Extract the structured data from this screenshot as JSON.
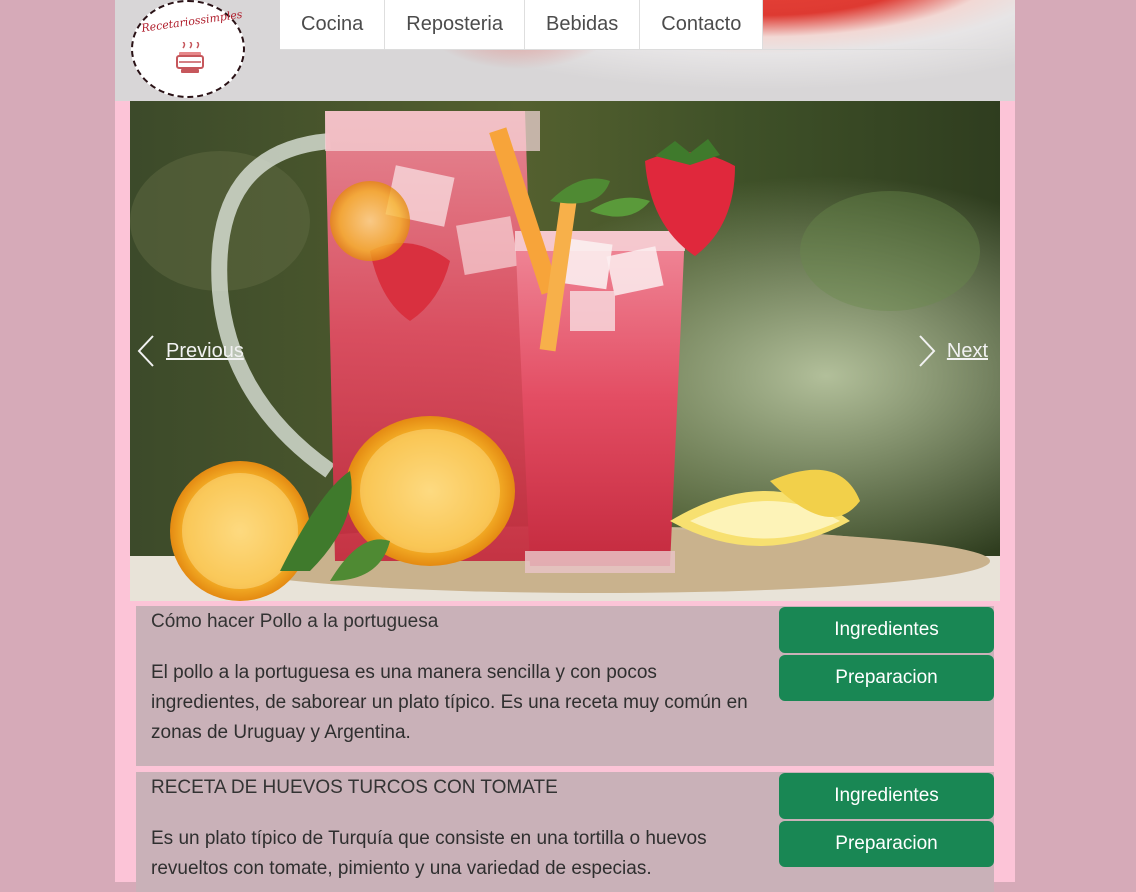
{
  "logo": {
    "text": "Recetariossimples"
  },
  "nav": {
    "items": [
      "Cocina",
      "Reposteria",
      "Bebidas",
      "Contacto"
    ]
  },
  "carousel": {
    "prev_label": "Previous",
    "next_label": "Next"
  },
  "recipes": [
    {
      "title": "Cómo hacer Pollo a la portuguesa",
      "description": "El pollo a la portuguesa es una manera sencilla y con pocos ingredientes, de saborear un plato típico. Es una receta muy común en zonas de Uruguay y Argentina.",
      "ingredients_label": "Ingredientes",
      "preparation_label": "Preparacion"
    },
    {
      "title": "RECETA DE HUEVOS TURCOS CON TOMATE",
      "description": "Es un plato típico de Turquía que consiste en una tortilla o huevos revueltos con tomate, pimiento y una variedad de especias.",
      "ingredients_label": "Ingredientes",
      "preparation_label": "Preparacion"
    }
  ],
  "colors": {
    "page_bg": "#d6aab8",
    "content_bg": "#fcc4d7",
    "card_bg": "#c9b1b8",
    "button_green": "#198754"
  }
}
